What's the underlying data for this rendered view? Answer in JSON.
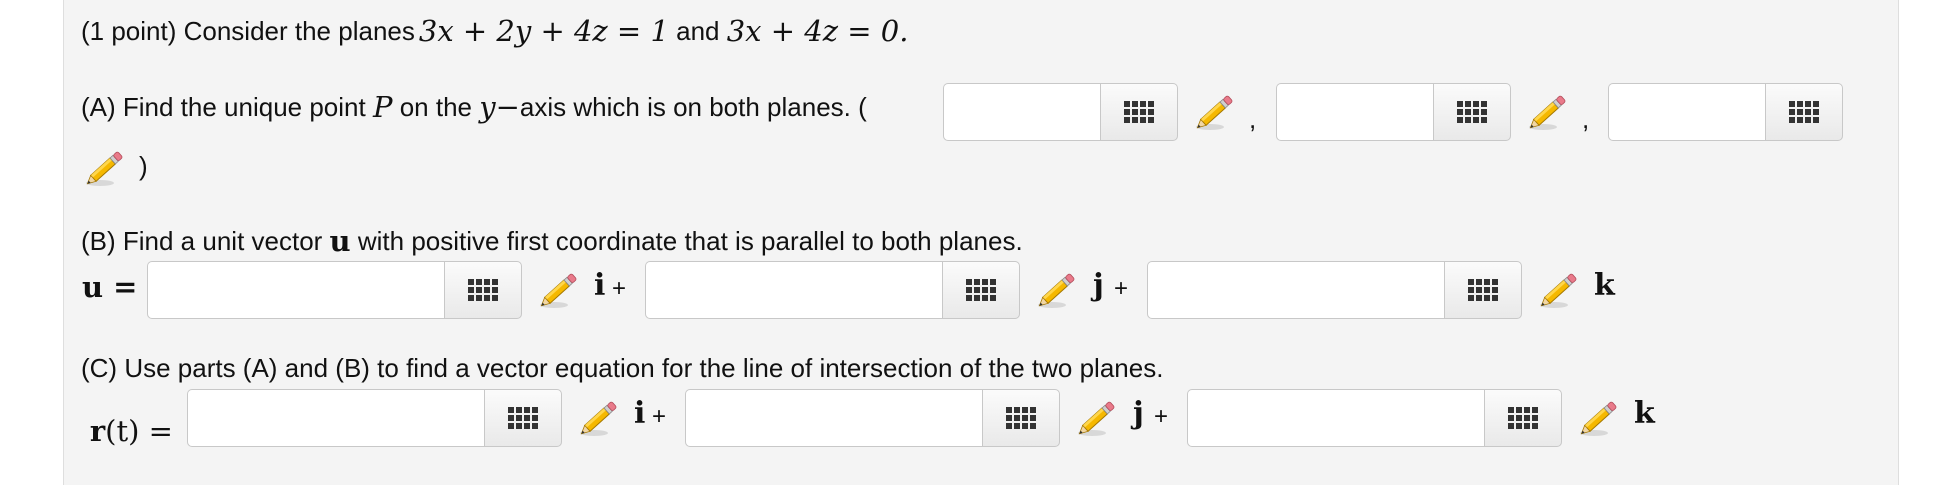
{
  "problem": {
    "intro_text": "(1 point) Consider the planes ",
    "plane1": "3x + 2y + 4z = 1",
    "and_text": " and ",
    "plane2": "3x + 4z = 0."
  },
  "partA": {
    "text_before_P": "(A) Find the unique point ",
    "P": "P",
    "text_on_the": " on the ",
    "y_axis": "y−",
    "text_after": "axis which is on both planes. (",
    "comma": ",",
    "close_paren": ")",
    "inputs": [
      "",
      "",
      ""
    ]
  },
  "partB": {
    "text_before_u": "(B) Find a unit vector ",
    "u": "u",
    "text_after": " with positive first coordinate that is parallel to both planes.",
    "lhs": "u =",
    "inputs": [
      "",
      "",
      ""
    ]
  },
  "partC": {
    "text": "(C) Use parts (A) and (B) to find a vector equation for the line of intersection of the two planes.",
    "lhs_r": "r",
    "lhs_rest": "(t) =",
    "inputs": [
      "",
      "",
      ""
    ]
  },
  "units": {
    "i": "i",
    "j": "j",
    "k": "k",
    "plus": "+"
  },
  "icons": {
    "keyboard": "keyboard-grid-icon",
    "pencil": "pencil-icon"
  }
}
